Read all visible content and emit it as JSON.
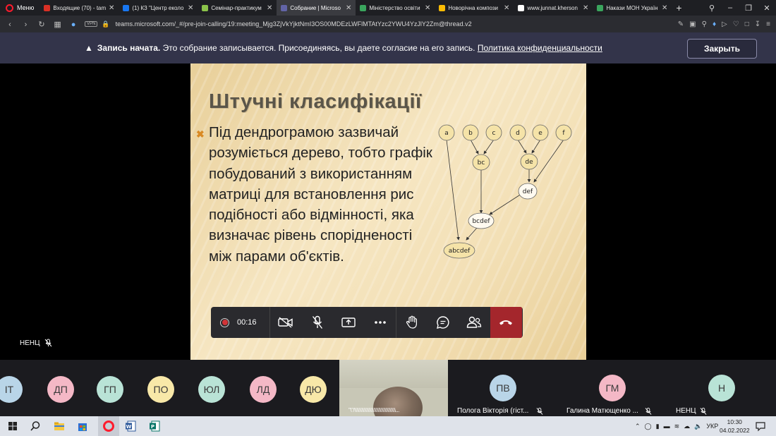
{
  "browser": {
    "menu_label": "Меню",
    "tabs": [
      {
        "title": "Входящие (70) - tam",
        "fav_color": "#d93025",
        "active": false
      },
      {
        "title": "(1) КЗ \"Центр еколо",
        "fav_color": "#1877f2",
        "active": false
      },
      {
        "title": "Семінар-практикум",
        "fav_color": "#8bc34a",
        "active": false
      },
      {
        "title": "Собрание | Microso",
        "fav_color": "#6264a7",
        "active": true
      },
      {
        "title": "Міністерство освіти",
        "fav_color": "#3aa55d",
        "active": false
      },
      {
        "title": "Новорічна компози",
        "fav_color": "#fbbc04",
        "active": false
      },
      {
        "title": "www.junnat.kherson",
        "fav_color": "#ffffff",
        "active": false
      },
      {
        "title": "Накази МОН Україн",
        "fav_color": "#3aa55d",
        "active": false
      }
    ],
    "vpn_label": "VPN",
    "url": "teams.microsoft.com/_#/pre-join-calling/19:meeting_Mjg3ZjVkYjktNmI3OS00MDEzLWFlMTAtYzc2YWU4YzJlY2Zm@thread.v2"
  },
  "banner": {
    "bold": "Запись начата.",
    "text": " Это собрание записывается. Присоединяясь, вы даете согласие на его запись. ",
    "link": "Политика конфиденциальности",
    "close_label": "Закрыть"
  },
  "slide": {
    "title": "Штучні класифікації",
    "body": "Під дендрограмою зазвичай розуміється дерево, тобто графік  побудований  з використанням матриці для встановлення  рис подібності або відмінності, яка визначає рівень спорідненості між парами об'єктів.",
    "dendrogram_nodes": [
      "a",
      "b",
      "c",
      "d",
      "e",
      "f",
      "bc",
      "de",
      "def",
      "bcdef",
      "abcdef"
    ]
  },
  "stage": {
    "presenter_label": "НЕНЦ"
  },
  "callbar": {
    "timer": "00:16"
  },
  "participants": [
    {
      "initials": "ІТ",
      "color": "#b9d5e8"
    },
    {
      "initials": "ДП",
      "color": "#f4b8c6"
    },
    {
      "initials": "ГП",
      "color": "#b9e3d6"
    },
    {
      "initials": "ПО",
      "color": "#f8e8a8"
    },
    {
      "initials": "ЮЛ",
      "color": "#b9e3d6"
    },
    {
      "initials": "ЛД",
      "color": "#f4b8c6"
    },
    {
      "initials": "ДЮ",
      "color": "#f8e8a8"
    },
    {
      "initials": "ПВ",
      "color": "#b9d5e8",
      "name": "Пологa Вікторія (гіст..."
    },
    {
      "initials": "ГМ",
      "color": "#f4b8c6",
      "name": "Галина Матющенко ..."
    },
    {
      "initials": "Н",
      "color": "#b9e3d6",
      "name": "НЕНЦ"
    }
  ],
  "video_caption": "\"\\\"/\\\\\\\\\\\\\\\\\\\\\\\\\\\\\\\\\\\\\\\\\\\\\\\\\\\\\\\\\\\\\\\\\\\\...",
  "taskbar": {
    "lang": "УКР",
    "time": "10:30",
    "date": "04.02.2022"
  }
}
